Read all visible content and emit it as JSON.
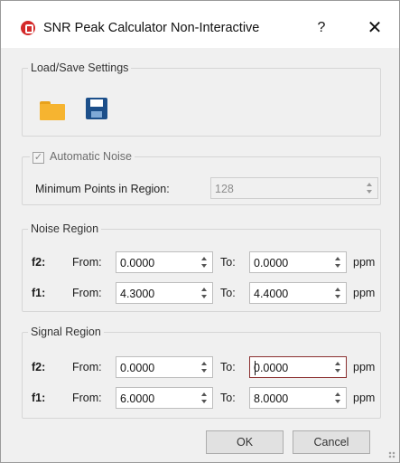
{
  "window": {
    "title": "SNR Peak Calculator Non-Interactive",
    "help_label": "?",
    "close_label": "✕"
  },
  "load_save": {
    "legend": "Load/Save Settings",
    "icons": [
      "folder-open-icon",
      "save-icon"
    ]
  },
  "automatic_noise": {
    "legend": "Automatic Noise",
    "checked": true,
    "check_mark": "✓",
    "min_points_label": "Minimum Points in Region:",
    "min_points_value": "128"
  },
  "noise_region": {
    "legend": "Noise Region",
    "rows": [
      {
        "name": "f2:",
        "from_label": "From:",
        "from": "0.0000",
        "to_label": "To:",
        "to": "0.0000",
        "unit": "ppm"
      },
      {
        "name": "f1:",
        "from_label": "From:",
        "from": "4.3000",
        "to_label": "To:",
        "to": "4.4000",
        "unit": "ppm"
      }
    ]
  },
  "signal_region": {
    "legend": "Signal Region",
    "rows": [
      {
        "name": "f2:",
        "from_label": "From:",
        "from": "0.0000",
        "to_label": "To:",
        "to": "0.0000",
        "unit": "ppm"
      },
      {
        "name": "f1:",
        "from_label": "From:",
        "from": "6.0000",
        "to_label": "To:",
        "to": "8.0000",
        "unit": "ppm"
      }
    ]
  },
  "buttons": {
    "ok": "OK",
    "cancel": "Cancel"
  },
  "colors": {
    "app_icon": "#d42a2a",
    "folder": "#f6b430",
    "save": "#1c4f8a",
    "focus_border": "#8b3030"
  }
}
